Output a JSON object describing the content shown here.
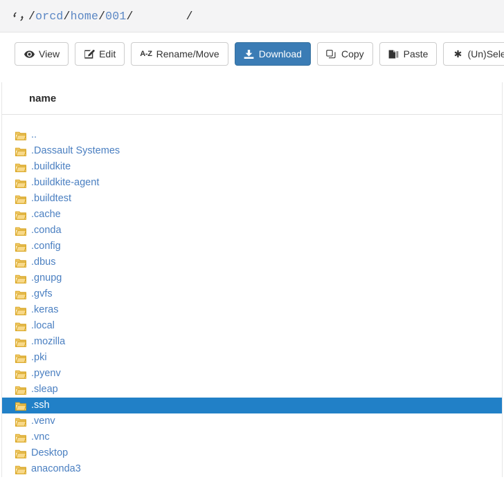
{
  "breadcrumb": {
    "sync_icon": "sync-icon",
    "root_sep": "/",
    "segments": [
      {
        "label": "orcd",
        "sep": "/"
      },
      {
        "label": "home",
        "sep": "/"
      },
      {
        "label": "001",
        "sep": "/"
      }
    ],
    "trailing": "/"
  },
  "toolbar": {
    "buttons": [
      {
        "label": "View",
        "icon": "eye-icon",
        "style": "default",
        "name": "view-button"
      },
      {
        "label": "Edit",
        "icon": "pencil-square-icon",
        "style": "default",
        "name": "edit-button"
      },
      {
        "label": "Rename/Move",
        "icon": "az-sort-icon",
        "style": "default",
        "name": "rename-move-button"
      },
      {
        "label": "Download",
        "icon": "download-icon",
        "style": "primary",
        "name": "download-button"
      },
      {
        "label": "Copy",
        "icon": "copy-icon",
        "style": "default",
        "name": "copy-button"
      },
      {
        "label": "Paste",
        "icon": "paste-icon",
        "style": "default",
        "name": "paste-button"
      },
      {
        "label": "(Un)Select All",
        "icon": "asterisk-icon",
        "style": "default",
        "name": "unselect-all-button"
      }
    ],
    "az_label": "A-Z",
    "asterisk_glyph": "✱"
  },
  "table": {
    "columns": [
      "name"
    ],
    "rows": [
      {
        "name": "..",
        "icon": "folder-icon",
        "selected": false
      },
      {
        "name": ".Dassault Systemes",
        "icon": "folder-icon",
        "selected": false
      },
      {
        "name": ".buildkite",
        "icon": "folder-icon",
        "selected": false
      },
      {
        "name": ".buildkite-agent",
        "icon": "folder-icon",
        "selected": false
      },
      {
        "name": ".buildtest",
        "icon": "folder-icon",
        "selected": false
      },
      {
        "name": ".cache",
        "icon": "folder-icon",
        "selected": false
      },
      {
        "name": ".conda",
        "icon": "folder-icon",
        "selected": false
      },
      {
        "name": ".config",
        "icon": "folder-icon",
        "selected": false
      },
      {
        "name": ".dbus",
        "icon": "folder-icon",
        "selected": false
      },
      {
        "name": ".gnupg",
        "icon": "folder-icon",
        "selected": false
      },
      {
        "name": ".gvfs",
        "icon": "folder-icon",
        "selected": false
      },
      {
        "name": ".keras",
        "icon": "folder-icon",
        "selected": false
      },
      {
        "name": ".local",
        "icon": "folder-icon",
        "selected": false
      },
      {
        "name": ".mozilla",
        "icon": "folder-icon",
        "selected": false
      },
      {
        "name": ".pki",
        "icon": "folder-icon",
        "selected": false
      },
      {
        "name": ".pyenv",
        "icon": "folder-icon",
        "selected": false
      },
      {
        "name": ".sleap",
        "icon": "folder-icon",
        "selected": false
      },
      {
        "name": ".ssh",
        "icon": "folder-icon",
        "selected": true
      },
      {
        "name": ".venv",
        "icon": "folder-icon",
        "selected": false
      },
      {
        "name": ".vnc",
        "icon": "folder-icon",
        "selected": false
      },
      {
        "name": "Desktop",
        "icon": "folder-icon",
        "selected": false
      },
      {
        "name": "anaconda3",
        "icon": "folder-icon",
        "selected": false
      }
    ]
  },
  "colors": {
    "accent_primary": "#3b7cb5",
    "selection": "#2180c7",
    "link": "#4a7fc1",
    "breadcrumb_link": "#5b87c4",
    "folder": "#f0c060",
    "header_bg": "#f4f4f5"
  }
}
